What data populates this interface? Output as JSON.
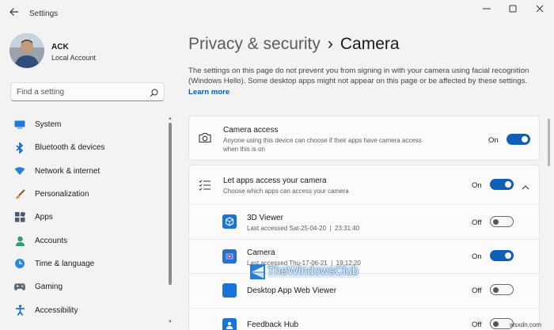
{
  "window": {
    "title": "Settings",
    "back_icon": "arrow-left-icon"
  },
  "user": {
    "name": "ACK",
    "account_type": "Local Account"
  },
  "search": {
    "placeholder": "Find a setting"
  },
  "sidebar": {
    "items": [
      {
        "label": "System",
        "icon": "system-display-icon"
      },
      {
        "label": "Bluetooth & devices",
        "icon": "bluetooth-icon"
      },
      {
        "label": "Network & internet",
        "icon": "wifi-icon"
      },
      {
        "label": "Personalization",
        "icon": "paintbrush-icon"
      },
      {
        "label": "Apps",
        "icon": "apps-grid-icon"
      },
      {
        "label": "Accounts",
        "icon": "accounts-person-icon"
      },
      {
        "label": "Time & language",
        "icon": "globe-clock-icon"
      },
      {
        "label": "Gaming",
        "icon": "gamepad-icon"
      },
      {
        "label": "Accessibility",
        "icon": "accessibility-icon"
      }
    ]
  },
  "header": {
    "breadcrumb_parent": "Privacy & security",
    "separator": "›",
    "current": "Camera"
  },
  "intro": {
    "text": "The settings on this page do not prevent you from signing in with your camera using facial recognition (Windows Hello). Some desktop apps might not appear on this page or be affected by these settings.",
    "link": "Learn more"
  },
  "camera_access": {
    "title": "Camera access",
    "description": "Anyone using this device can choose if their apps have camera access when this is on",
    "state_label": "On",
    "enabled": true,
    "icon": "camera-icon"
  },
  "apps_access": {
    "title": "Let apps access your camera",
    "description": "Choose which apps can access your camera",
    "state_label": "On",
    "enabled": true,
    "icon": "list-checklist-icon",
    "expand_icon": "chevron-up-icon",
    "apps": [
      {
        "name": "3D Viewer",
        "last_accessed": "Last accessed Sat-25-04-20  |  23:31:40",
        "state_label": "Off",
        "enabled": false,
        "icon": "3d-viewer-icon"
      },
      {
        "name": "Camera",
        "last_accessed": "Last accessed Thu-17-06-21  |  19:12:20",
        "state_label": "On",
        "enabled": true,
        "icon": "camera-app-icon"
      },
      {
        "name": "Desktop App Web Viewer",
        "last_accessed": "",
        "state_label": "Off",
        "enabled": false,
        "icon": "web-viewer-icon"
      },
      {
        "name": "Feedback Hub",
        "last_accessed": "",
        "state_label": "Off",
        "enabled": false,
        "icon": "feedback-hub-icon"
      }
    ]
  },
  "watermark": {
    "text": "TheWindowsClub",
    "icon": "windows-club-logo"
  },
  "corner_tag": "wsxdn.com",
  "colors": {
    "accent": "#0f5fb8",
    "background": "#f3f3f3",
    "card": "#fbfbfb",
    "link": "#0b5cad"
  }
}
